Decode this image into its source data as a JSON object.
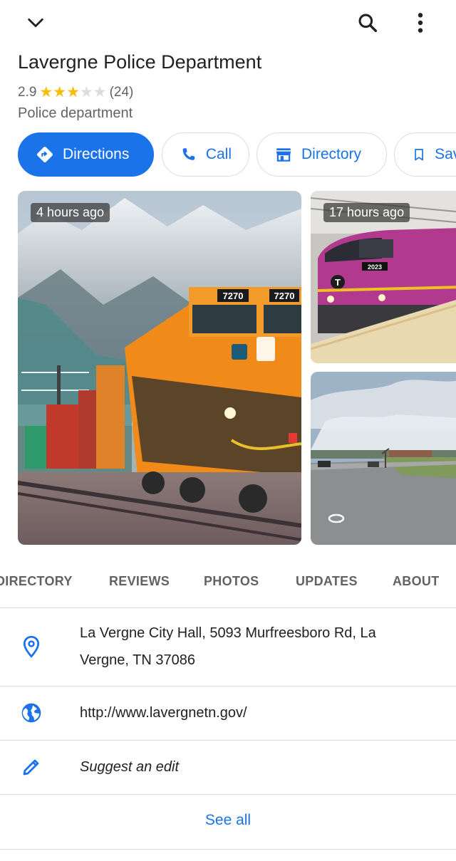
{
  "topbar": {
    "collapse_icon": "chevron-down-icon",
    "search_icon": "search-icon",
    "more_icon": "more-vert-icon"
  },
  "place": {
    "name": "Lavergne Police Department",
    "rating": "2.9",
    "rating_value": 2.9,
    "review_count": "(24)",
    "category": "Police department"
  },
  "actions": {
    "directions": "Directions",
    "call": "Call",
    "directory": "Directory",
    "save": "Save"
  },
  "photos": [
    {
      "badge": "4 hours ago",
      "caption_primary": "7270",
      "caption_secondary": "7270"
    },
    {
      "badge": "17 hours ago",
      "train_number": "2023"
    },
    {
      "badge": "",
      "icon": "street-view-360-icon"
    }
  ],
  "tabs": [
    "DIRECTORY",
    "REVIEWS",
    "PHOTOS",
    "UPDATES",
    "ABOUT"
  ],
  "details": {
    "address": "La Vergne City Hall, 5093 Murfreesboro Rd, La Vergne, TN 37086",
    "website": "http://www.lavergnetn.gov/",
    "suggest_edit": "Suggest an edit",
    "see_all": "See all"
  },
  "colors": {
    "accent": "#1a73e8",
    "star": "#fbbc04",
    "divider": "#dadce0",
    "secondary_text": "#5f6368"
  }
}
